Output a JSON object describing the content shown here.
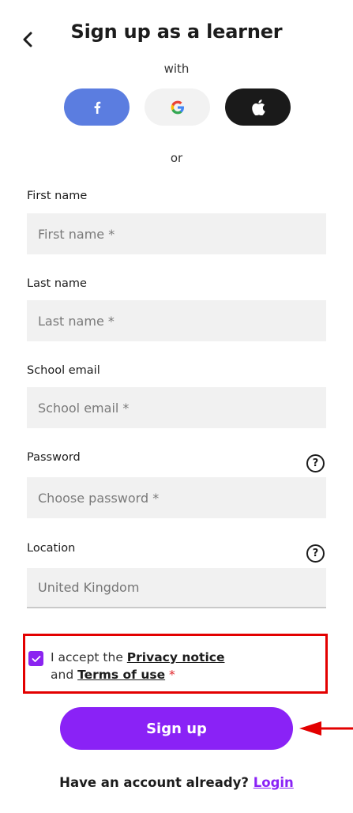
{
  "header": {
    "title": "Sign up as a learner"
  },
  "social": {
    "with_label": "with",
    "or_label": "or"
  },
  "form": {
    "first_name": {
      "label": "First name",
      "placeholder": "First name *"
    },
    "last_name": {
      "label": "Last name",
      "placeholder": "Last name *"
    },
    "email": {
      "label": "School email",
      "placeholder": "School email *"
    },
    "password": {
      "label": "Password",
      "placeholder": "Choose password *",
      "help": "?"
    },
    "location": {
      "label": "Location",
      "value": "United Kingdom",
      "help": "?"
    }
  },
  "terms": {
    "checked": true,
    "prefix": "I accept the ",
    "privacy_link": "Privacy notice",
    "and_text": "and ",
    "terms_link": "Terms of use",
    "required_mark": " *"
  },
  "signup_button": {
    "label": "Sign up"
  },
  "footer": {
    "question": "Have an account already?",
    "login_link": "Login"
  },
  "colors": {
    "accent": "#8a22f6",
    "facebook": "#5b7de0",
    "apple": "#1a1a1a",
    "highlight_box": "#e30000"
  }
}
